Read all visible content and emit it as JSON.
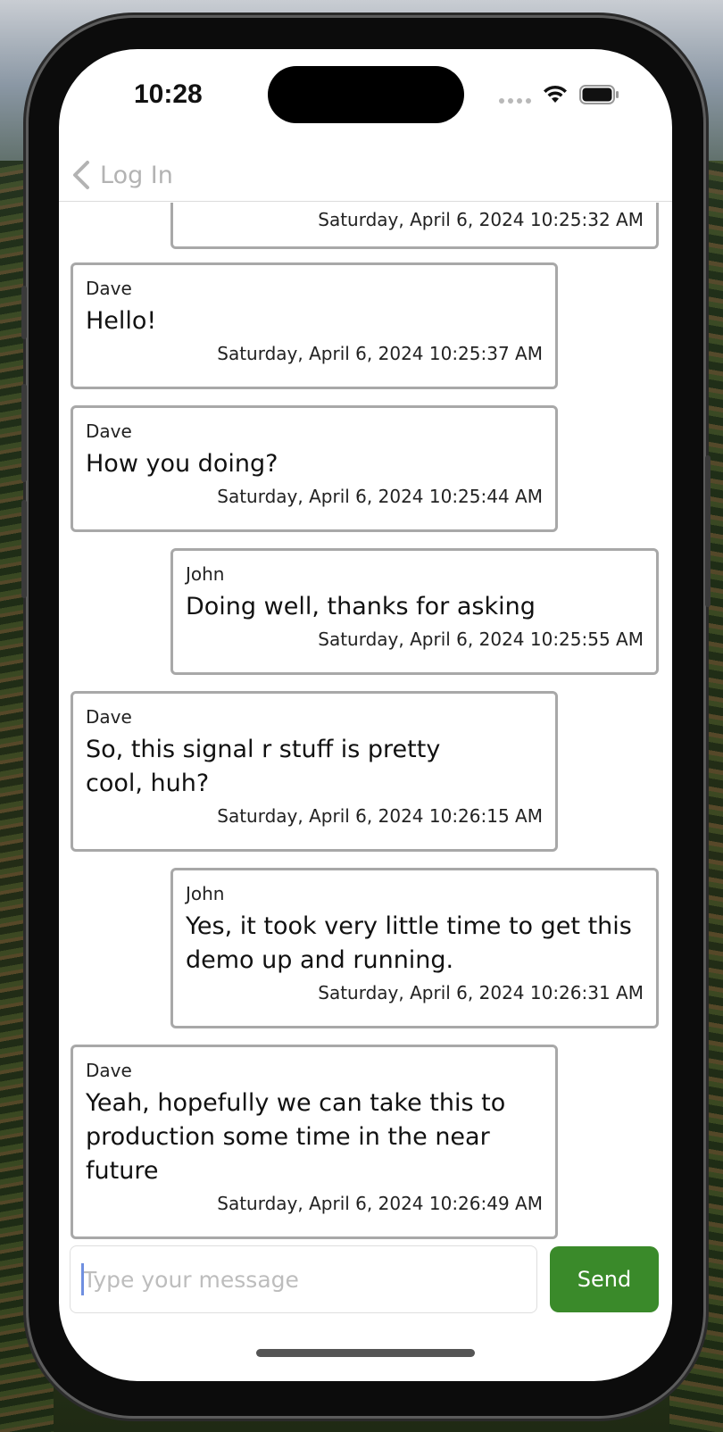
{
  "status_bar": {
    "time": "10:28"
  },
  "nav": {
    "back_label": "Log In"
  },
  "messages": [
    {
      "sender": "",
      "text": "",
      "timestamp": "Saturday, April 6, 2024 10:25:32 AM",
      "side": "right"
    },
    {
      "sender": "Dave",
      "text": "Hello!",
      "timestamp": "Saturday, April 6, 2024 10:25:37 AM",
      "side": "left"
    },
    {
      "sender": "Dave",
      "text": "How you doing?",
      "timestamp": "Saturday, April 6, 2024 10:25:44 AM",
      "side": "left"
    },
    {
      "sender": "John",
      "text": "Doing well, thanks for asking",
      "timestamp": "Saturday, April 6, 2024 10:25:55 AM",
      "side": "right"
    },
    {
      "sender": "Dave",
      "text": "So, this signal r stuff is pretty cool, huh?",
      "timestamp": "Saturday, April 6, 2024 10:26:15 AM",
      "side": "left"
    },
    {
      "sender": "John",
      "text": "Yes, it took very little time to get this demo up and running.",
      "timestamp": "Saturday, April 6, 2024 10:26:31 AM",
      "side": "right"
    },
    {
      "sender": "Dave",
      "text": "Yeah, hopefully we can take this to production some time in the near future",
      "timestamp": "Saturday, April 6, 2024 10:26:49 AM",
      "side": "left"
    }
  ],
  "composer": {
    "placeholder": "Type your message",
    "value": "",
    "send_label": "Send"
  },
  "colors": {
    "send_button": "#3a8a2a",
    "bubble_border": "#a8a8a8",
    "back_label": "#b3b3b3"
  }
}
